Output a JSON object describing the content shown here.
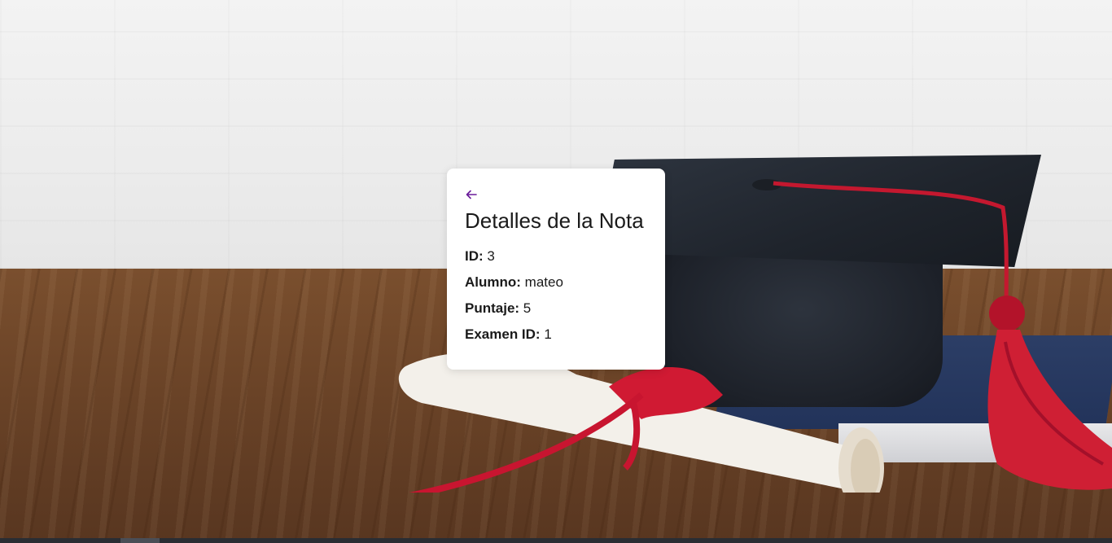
{
  "card": {
    "back_icon": "arrow-left-icon",
    "title": "Detalles de la Nota",
    "details": [
      {
        "label": "ID:",
        "value": "3"
      },
      {
        "label": "Alumno:",
        "value": "mateo"
      },
      {
        "label": "Puntaje:",
        "value": "5"
      },
      {
        "label": "Examen ID:",
        "value": "1"
      }
    ]
  },
  "colors": {
    "accent": "#6a1b9a",
    "card_bg": "#ffffff",
    "text": "#1a1a1a"
  }
}
